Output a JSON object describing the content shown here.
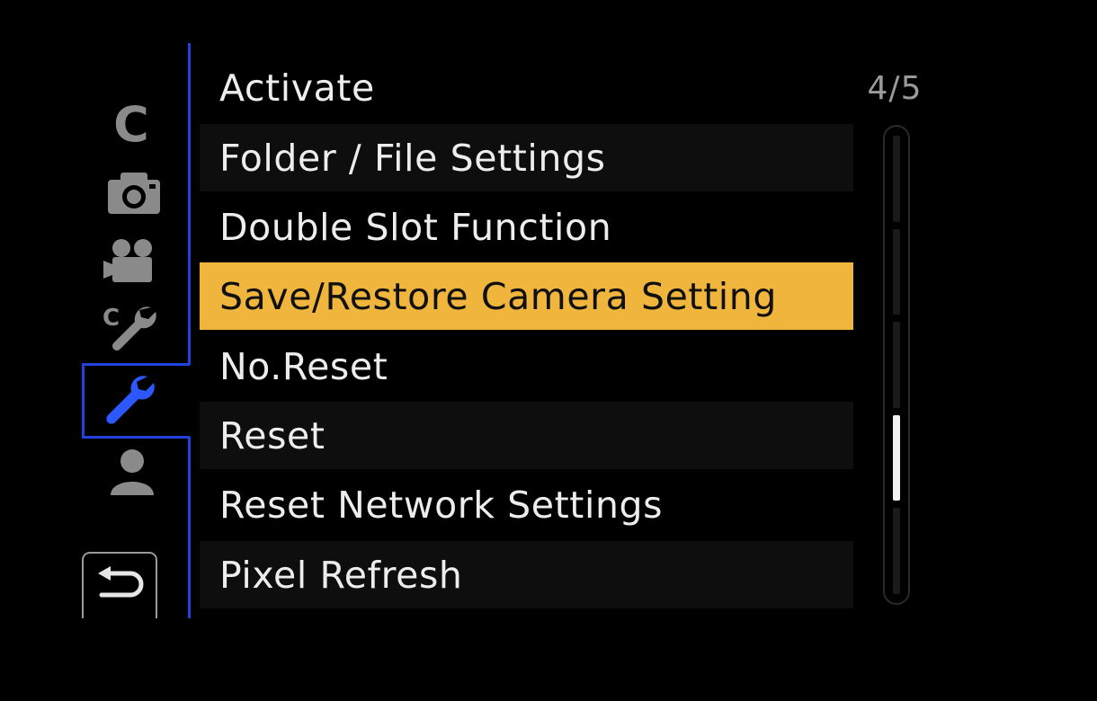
{
  "tabs": [
    {
      "id": "custom",
      "label": "C",
      "icon": "custom-c-icon"
    },
    {
      "id": "photo",
      "icon": "camera-icon"
    },
    {
      "id": "video",
      "icon": "movie-camera-icon"
    },
    {
      "id": "custom-setup",
      "icon": "custom-wrench-icon"
    },
    {
      "id": "setup",
      "icon": "wrench-icon",
      "active": true
    },
    {
      "id": "my-menu",
      "icon": "person-icon"
    }
  ],
  "back_button": {
    "icon": "return-arrow-icon"
  },
  "menu": {
    "items": [
      {
        "label": "Activate",
        "selected": false
      },
      {
        "label": "Folder / File Settings",
        "selected": false
      },
      {
        "label": "Double Slot Function",
        "selected": false
      },
      {
        "label": "Save/Restore Camera Setting",
        "selected": true
      },
      {
        "label": "No.Reset",
        "selected": false
      },
      {
        "label": "Reset",
        "selected": false
      },
      {
        "label": "Reset Network Settings",
        "selected": false
      },
      {
        "label": "Pixel Refresh",
        "selected": false
      }
    ]
  },
  "pagination": {
    "label": "4/5",
    "current_page": 4,
    "total_pages": 5
  },
  "colors": {
    "accent_blue": "#2340e0",
    "selection_yellow": "#f0b53c",
    "text": "#ededed",
    "inactive_icon": "#8a8a8a"
  }
}
